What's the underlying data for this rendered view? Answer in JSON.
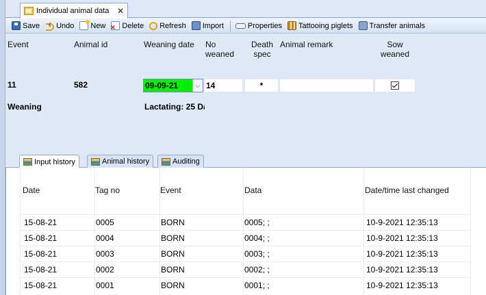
{
  "window": {
    "tab_title": "Individual animal data"
  },
  "toolbar": {
    "save": "Save",
    "undo": "Undo",
    "new": "New",
    "delete": "Delete",
    "refresh": "Refresh",
    "import": "Import",
    "properties": "Properties",
    "tattooing": "Tattooing piglets",
    "transfer": "Transfer animals"
  },
  "form": {
    "headers": {
      "event": "Event",
      "animal_id": "Animal id",
      "weaning_date": "Weaning date",
      "no_weaned_1": "No",
      "no_weaned_2": "weaned",
      "death_spec_1": "Death",
      "death_spec_2": "spec",
      "animal_remark": "Animal remark",
      "sow_weaned_1": "Sow",
      "sow_weaned_2": "weaned"
    },
    "values": {
      "event": "11",
      "animal_id": "582",
      "weaning_date": "09-09-21",
      "no_weaned": "14",
      "death_spec": "*",
      "animal_remark": "",
      "sow_weaned": true
    },
    "event_label": "Weaning",
    "status_label": "Lactating: 25 Da",
    "weaning_date_color": "#00ee00"
  },
  "bottom_tabs": [
    {
      "label": "Input history",
      "active": true
    },
    {
      "label": "Animal history",
      "active": false
    },
    {
      "label": "Auditing",
      "active": false
    }
  ],
  "history": {
    "columns": [
      "Date",
      "Tag no",
      "Event",
      "Data",
      "Date/time last changed"
    ],
    "rows": [
      [
        "15-08-21",
        "0005",
        "BORN",
        "0005; ;",
        "10-9-2021 12:35:13"
      ],
      [
        "15-08-21",
        "0004",
        "BORN",
        "0004; ;",
        "10-9-2021 12:35:13"
      ],
      [
        "15-08-21",
        "0003",
        "BORN",
        "0003; ;",
        "10-9-2021 12:35:13"
      ],
      [
        "15-08-21",
        "0002",
        "BORN",
        "0002; ;",
        "10-9-2021 12:35:13"
      ],
      [
        "15-08-21",
        "0001",
        "BORN",
        "0001; ;",
        "10-9-2021 12:35:13"
      ]
    ]
  }
}
